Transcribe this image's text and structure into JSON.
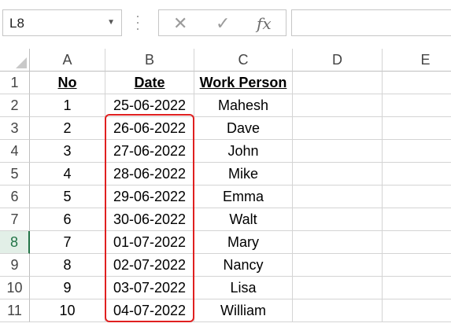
{
  "namebox": {
    "value": "L8"
  },
  "formula_bar": {
    "cancel_glyph": "✕",
    "enter_glyph": "✓",
    "fx_label": "fx",
    "value": ""
  },
  "columns": [
    "A",
    "B",
    "C",
    "D",
    "E"
  ],
  "rows": [
    "1",
    "2",
    "3",
    "4",
    "5",
    "6",
    "7",
    "8",
    "9",
    "10",
    "11"
  ],
  "active_row": "8",
  "table": {
    "headers": [
      "No",
      "Date",
      "Work Person"
    ],
    "data": [
      [
        "1",
        "25-06-2022",
        "Mahesh"
      ],
      [
        "2",
        "26-06-2022",
        "Dave"
      ],
      [
        "3",
        "27-06-2022",
        "John"
      ],
      [
        "4",
        "28-06-2022",
        "Mike"
      ],
      [
        "5",
        "29-06-2022",
        "Emma"
      ],
      [
        "6",
        "30-06-2022",
        "Walt"
      ],
      [
        "7",
        "01-07-2022",
        "Mary"
      ],
      [
        "8",
        "02-07-2022",
        "Nancy"
      ],
      [
        "9",
        "03-07-2022",
        "Lisa"
      ],
      [
        "10",
        "04-07-2022",
        "William"
      ]
    ]
  },
  "colors": {
    "highlight": "#e02020",
    "active_row": "#217346"
  }
}
